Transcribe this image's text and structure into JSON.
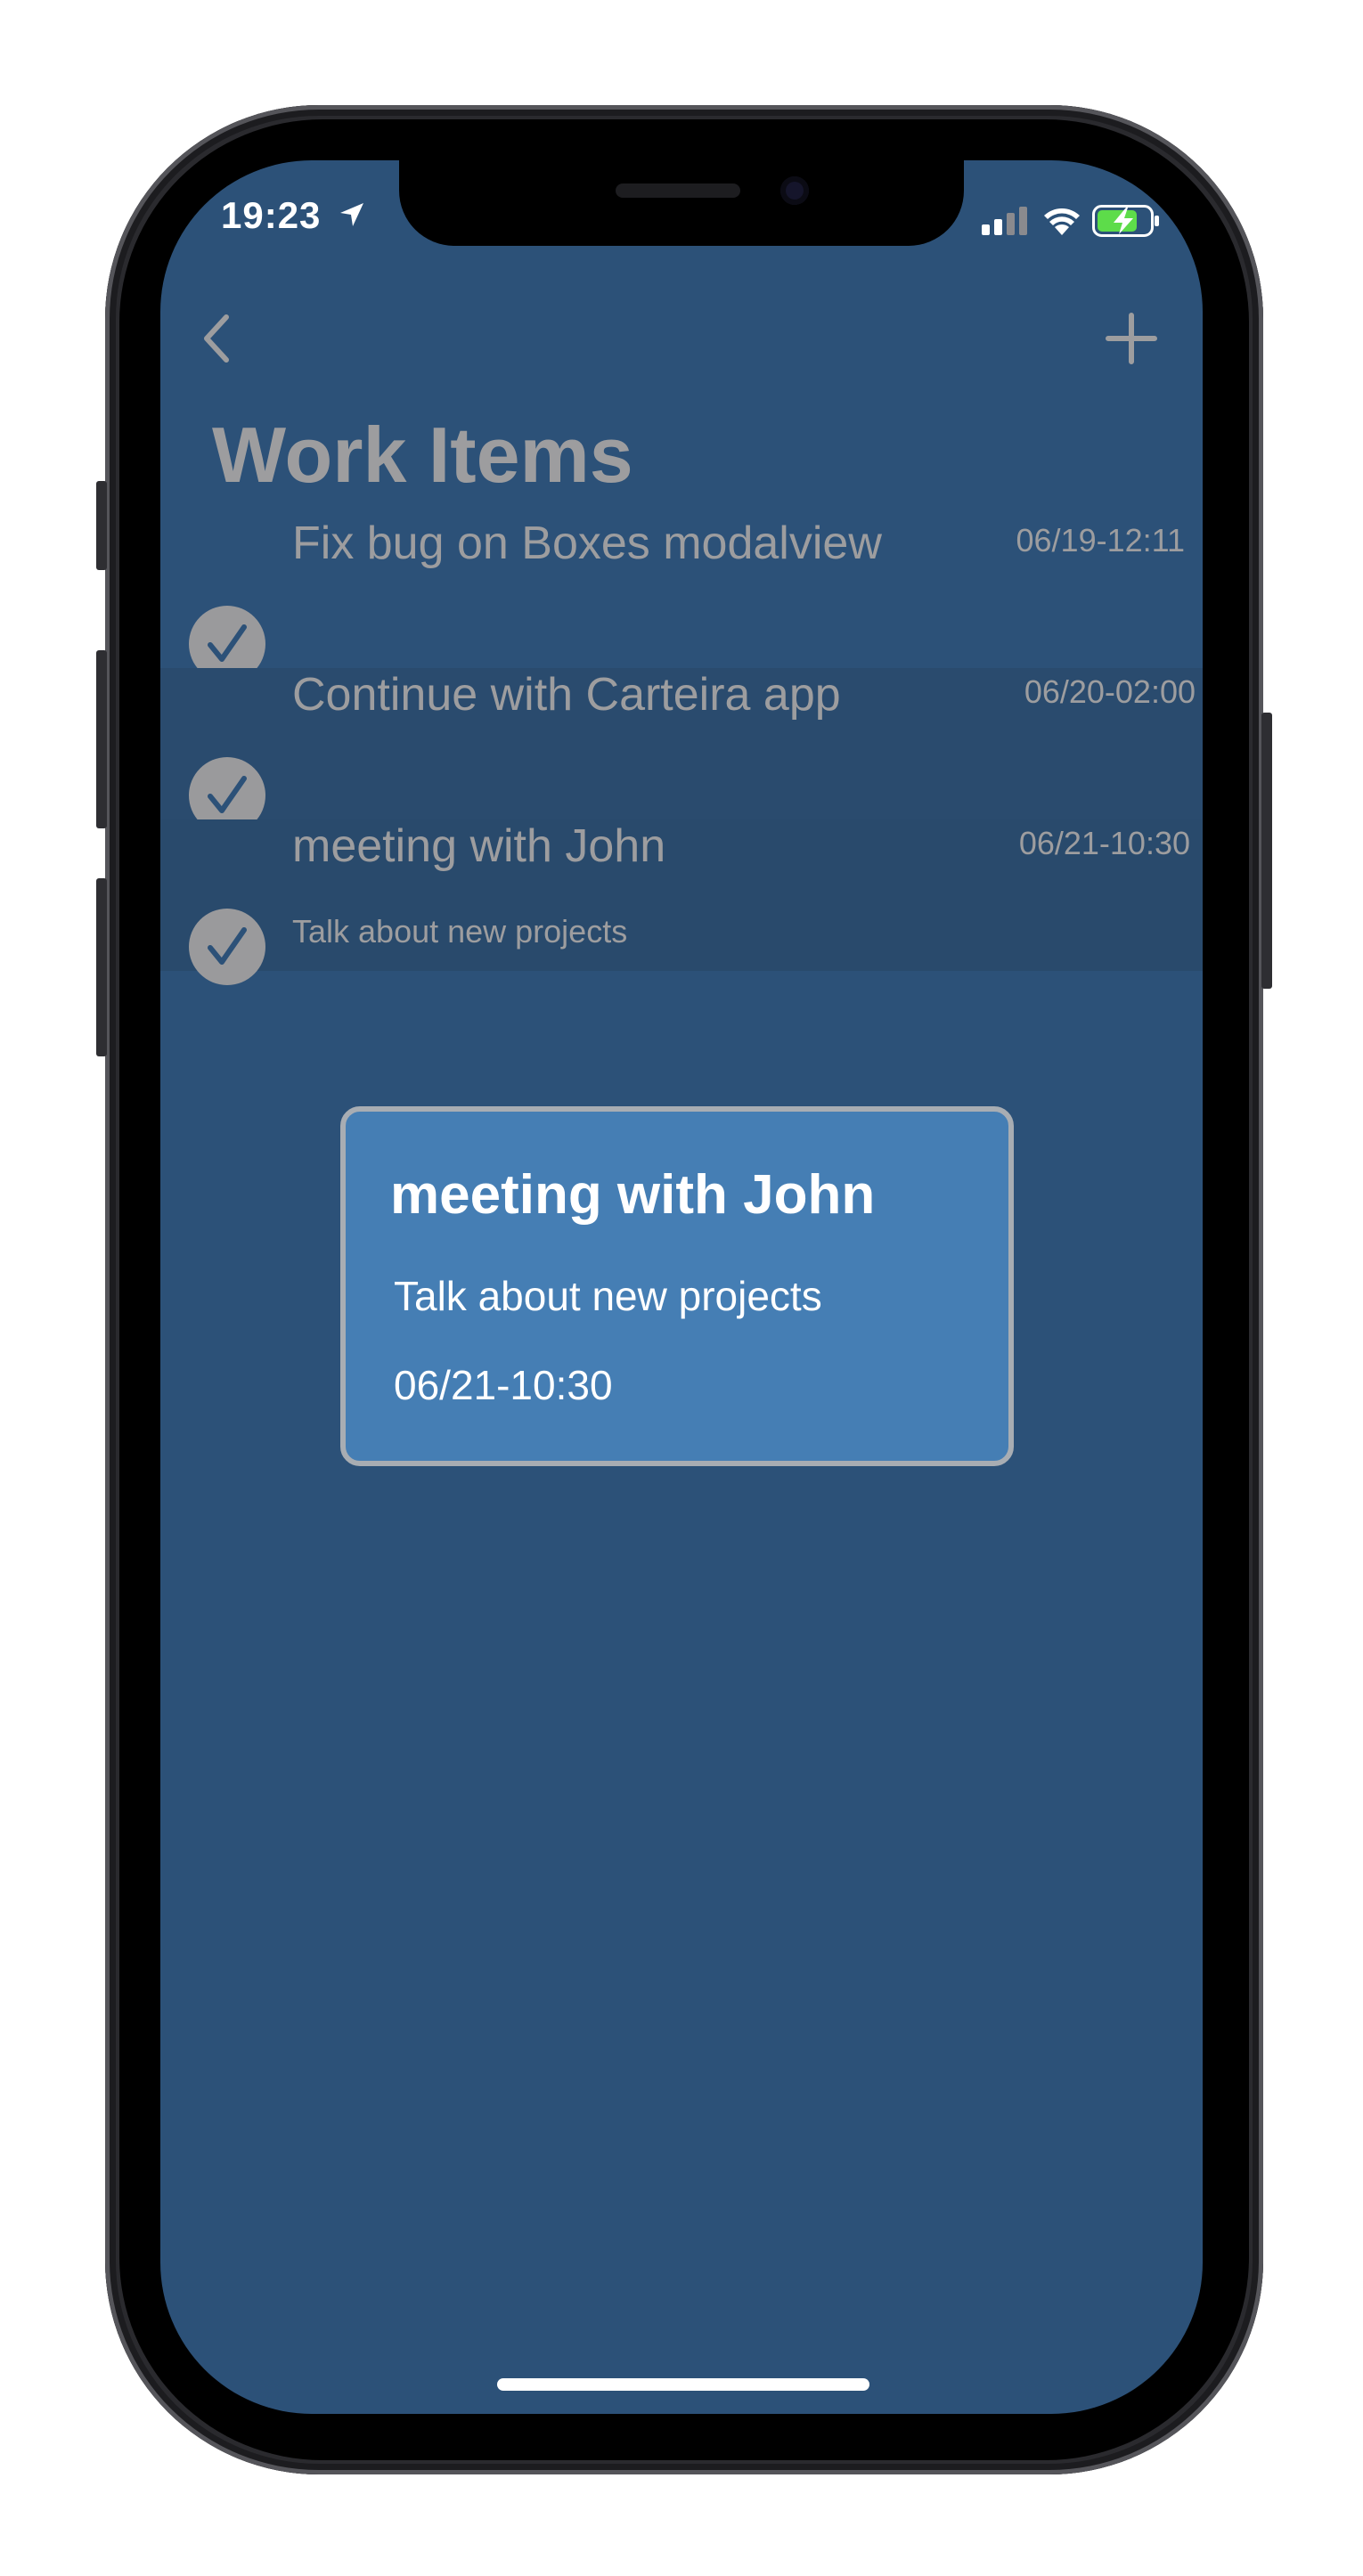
{
  "status_bar": {
    "time": "19:23"
  },
  "nav": {
    "title": "Work Items"
  },
  "tasks": [
    {
      "title": "Fix bug on Boxes modalview",
      "date": "06/19-12:11",
      "note": ""
    },
    {
      "title": "Continue with Carteira app",
      "date": "06/20-02:00",
      "note": ""
    },
    {
      "title": "meeting with John",
      "date": "06/21-10:30",
      "note": "Talk about new projects"
    }
  ],
  "detail": {
    "title": "meeting with John",
    "note": "Talk about new projects",
    "date": "06/21-10:30"
  },
  "colors": {
    "background": "#2c5178",
    "card": "#457eb4",
    "muted_text": "#9d9d9f",
    "battery_green": "#5ddc4a"
  }
}
